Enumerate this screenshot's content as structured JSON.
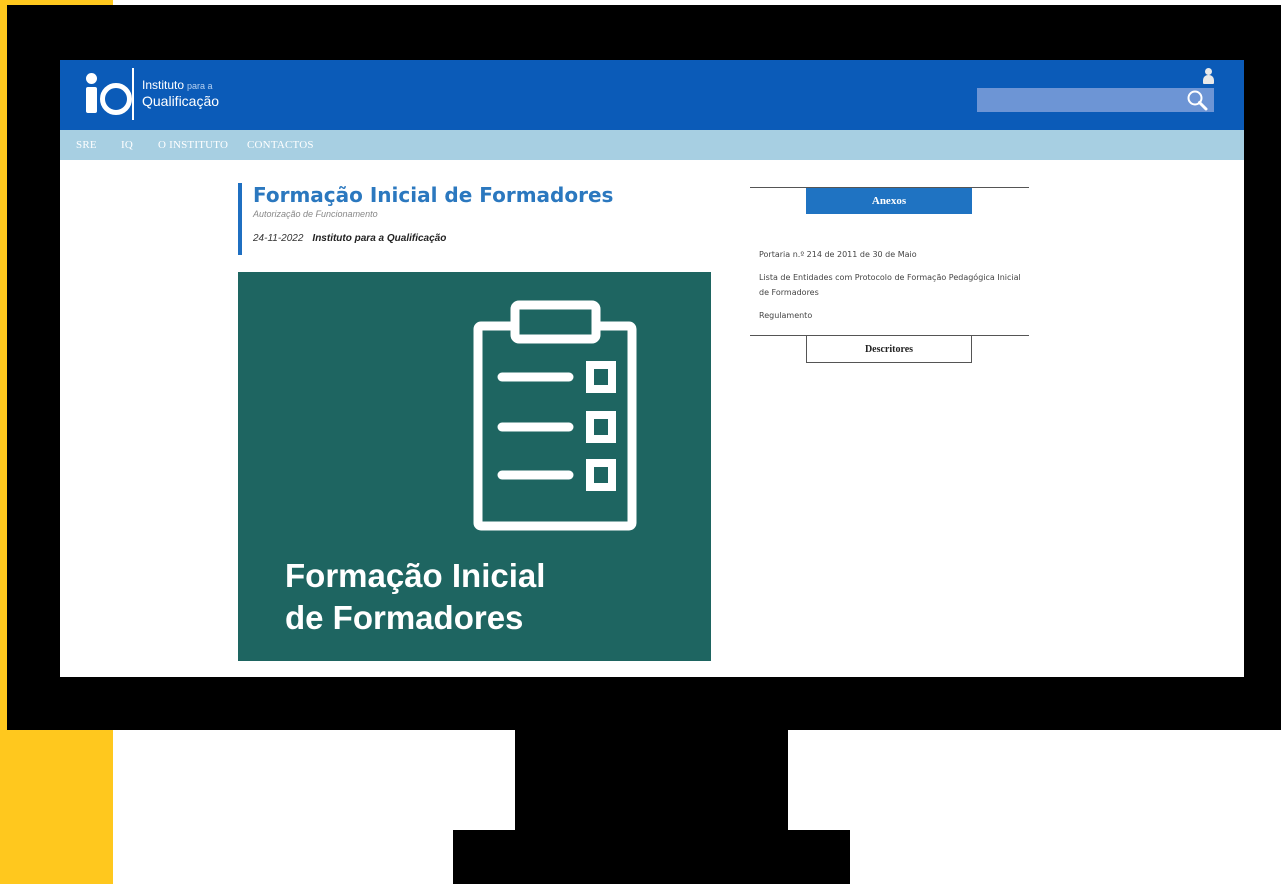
{
  "colors": {
    "accent_yellow": "#ffc81e",
    "header_blue": "#0b5bb8",
    "nav_lightblue": "#a7cfe2",
    "hero_green": "#1e6561",
    "title_blue": "#2b78bf"
  },
  "header": {
    "logo": {
      "line1": "Instituto",
      "line1_small": "para a",
      "line2": "Qualificação"
    },
    "search": {
      "placeholder": ""
    }
  },
  "nav": {
    "items": [
      {
        "label": "SRE"
      },
      {
        "label": "IQ"
      },
      {
        "label": "O INSTITUTO"
      },
      {
        "label": "CONTACTOS"
      }
    ]
  },
  "article": {
    "title": "Formação Inicial de Formadores",
    "subtitle": "Autorização de Funcionamento",
    "date": "24-11-2022",
    "author": "Instituto para a Qualificação",
    "hero_text_line1": "Formação Inicial",
    "hero_text_line2": "de Formadores"
  },
  "sidebar": {
    "anexos_label": "Anexos",
    "links": [
      {
        "label": "Portaria n.º 214 de 2011 de 30 de Maio"
      },
      {
        "label": "Lista de Entidades com Protocolo de Formação Pedagógica Inicial de Formadores"
      },
      {
        "label": "Regulamento"
      }
    ],
    "descritores_label": "Descritores"
  }
}
